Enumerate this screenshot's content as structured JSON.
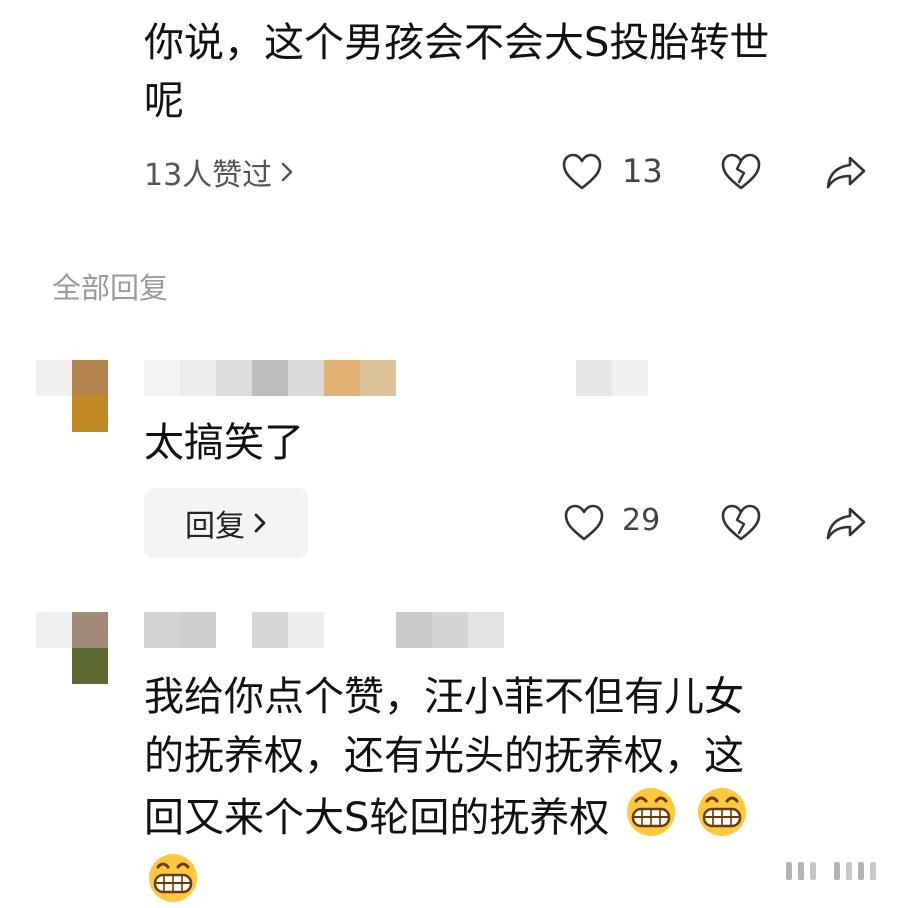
{
  "top_comment": {
    "text_line1": "你说，这个男孩会不会大S投胎转世",
    "text_line2": "呢",
    "likers_summary": "13人赞过",
    "like_count": "13"
  },
  "section": {
    "title": "全部回复"
  },
  "replies": [
    {
      "text": "太搞笑了",
      "reply_label": "回复",
      "like_count": "29"
    },
    {
      "text_line1": "我给你点个赞，汪小菲不但有儿女",
      "text_line2": "的抚养权，还有光头的抚养权，这",
      "text_line3": "回又来个大S轮回的抚养权",
      "emoji_count": 3
    }
  ],
  "icons": {
    "like": "heart-outline-icon",
    "dislike": "broken-heart-icon",
    "share": "share-arrow-icon",
    "chevron": "chevron-right-icon",
    "emoji": "grinning-face-emoji"
  }
}
